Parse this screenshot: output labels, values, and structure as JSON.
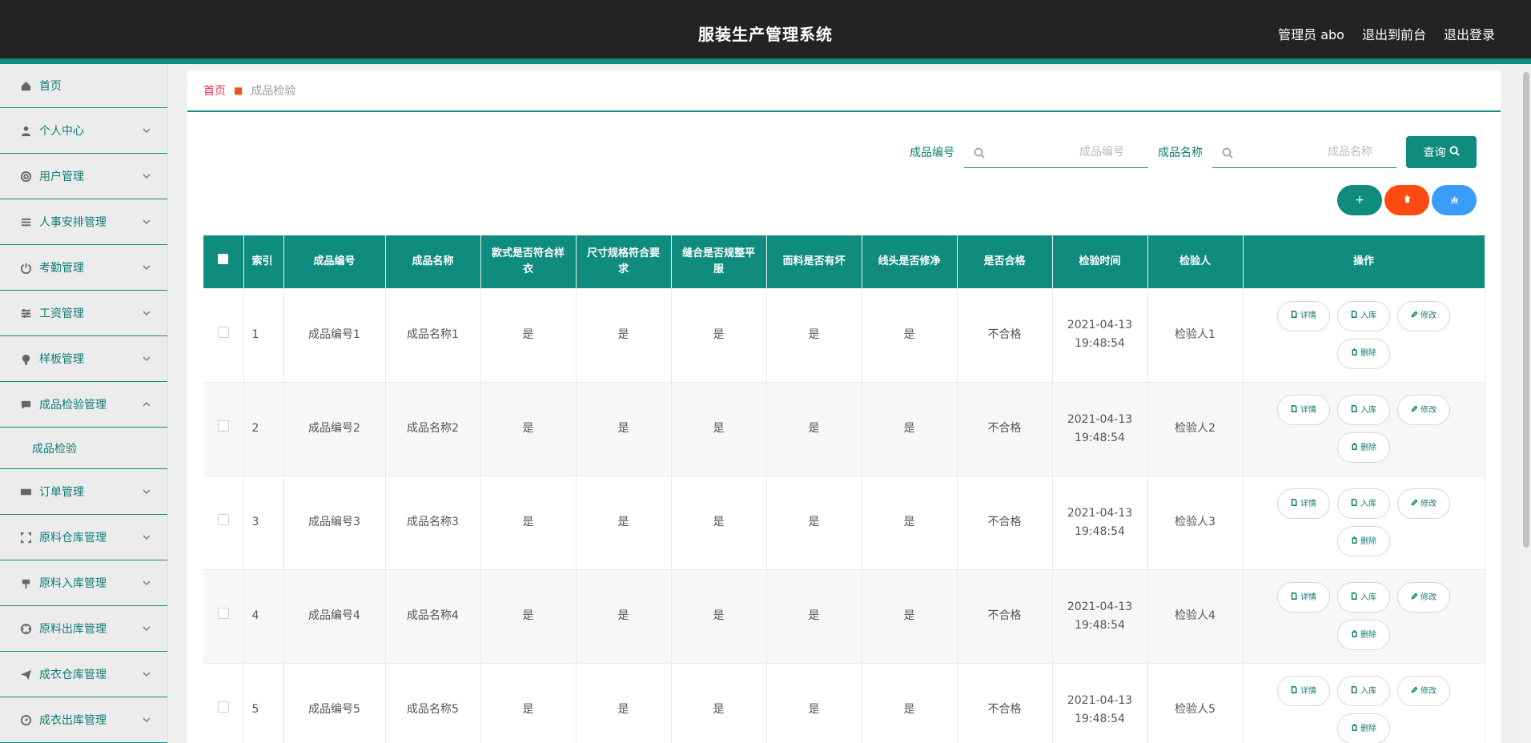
{
  "app": {
    "title": "服装生产管理系统"
  },
  "header": {
    "user": "管理员 abo",
    "front": "退出到前台",
    "logout": "退出登录"
  },
  "sidebar": {
    "items": [
      {
        "label": "首页",
        "icon": "home-icon"
      },
      {
        "label": "个人中心",
        "icon": "user-icon"
      },
      {
        "label": "用户管理",
        "icon": "lifebuoy-icon"
      },
      {
        "label": "人事安排管理",
        "icon": "list-icon"
      },
      {
        "label": "考勤管理",
        "icon": "power-icon"
      },
      {
        "label": "工资管理",
        "icon": "sliders-icon"
      },
      {
        "label": "样板管理",
        "icon": "bulb-icon"
      },
      {
        "label": "成品检验管理",
        "icon": "chat-icon"
      },
      {
        "label": "订单管理",
        "icon": "ticket-icon"
      },
      {
        "label": "原料仓库管理",
        "icon": "frame-icon"
      },
      {
        "label": "原料入库管理",
        "icon": "stamp-icon"
      },
      {
        "label": "原料出库管理",
        "icon": "target-icon"
      },
      {
        "label": "成衣仓库管理",
        "icon": "send-icon"
      },
      {
        "label": "成衣出库管理",
        "icon": "compass-icon"
      }
    ],
    "sub_item": "成品检验"
  },
  "breadcrumb": {
    "home": "首页",
    "current": "成品检验"
  },
  "search": {
    "code_label": "成品编号",
    "code_placeholder": "成品编号",
    "name_label": "成品名称",
    "name_placeholder": "成品名称",
    "query": "查询"
  },
  "table": {
    "headers": [
      "索引",
      "成品编号",
      "成品名称",
      "款式是否符合样衣",
      "尺寸规格符合要求",
      "缝合是否规整平服",
      "面料是否有坏",
      "线头是否修净",
      "是否合格",
      "检验时间",
      "检验人",
      "操作"
    ],
    "ops": {
      "detail": "详情",
      "stock": "入库",
      "edit": "修改",
      "delete": "删除"
    },
    "rows": [
      [
        "1",
        "成品编号1",
        "成品名称1",
        "是",
        "是",
        "是",
        "是",
        "是",
        "不合格",
        "2021-04-13 19:48:54",
        "检验人1"
      ],
      [
        "2",
        "成品编号2",
        "成品名称2",
        "是",
        "是",
        "是",
        "是",
        "是",
        "不合格",
        "2021-04-13 19:48:54",
        "检验人2"
      ],
      [
        "3",
        "成品编号3",
        "成品名称3",
        "是",
        "是",
        "是",
        "是",
        "是",
        "不合格",
        "2021-04-13 19:48:54",
        "检验人3"
      ],
      [
        "4",
        "成品编号4",
        "成品名称4",
        "是",
        "是",
        "是",
        "是",
        "是",
        "不合格",
        "2021-04-13 19:48:54",
        "检验人4"
      ],
      [
        "5",
        "成品编号5",
        "成品名称5",
        "是",
        "是",
        "是",
        "是",
        "是",
        "不合格",
        "2021-04-13 19:48:54",
        "检验人5"
      ]
    ]
  },
  "colors": {
    "primary": "#0f8c7d",
    "danger": "#ff4a12",
    "info": "#3a9cf6",
    "topbar": "#232323"
  }
}
